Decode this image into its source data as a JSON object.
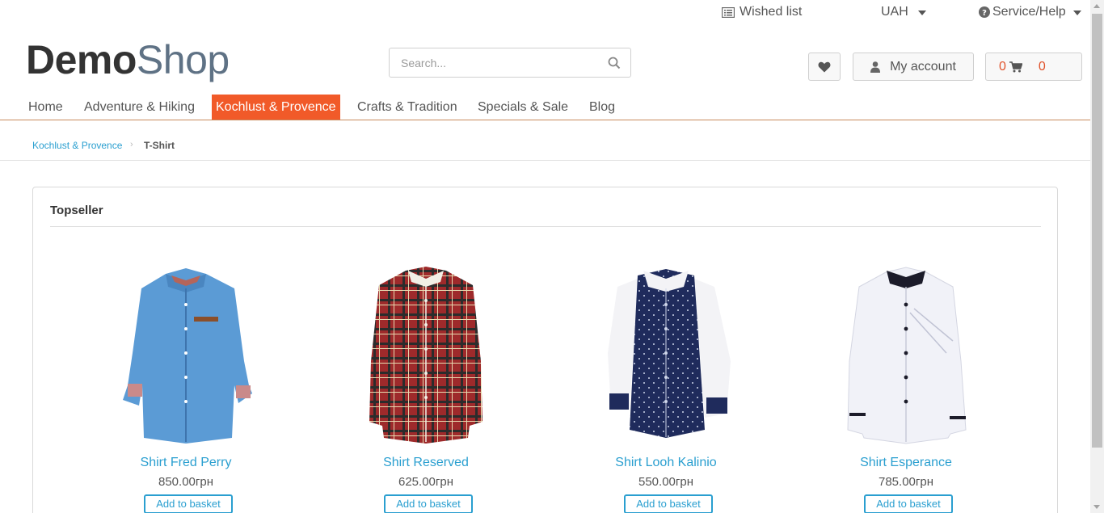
{
  "topbar": {
    "wished_list": "Wished list",
    "currency": "UAH",
    "service": "Service/Help"
  },
  "logo": {
    "part1": "Demo",
    "part2": "Shop"
  },
  "search": {
    "placeholder": "Search..."
  },
  "header": {
    "account_label": "My account",
    "cart_count": "0",
    "cart_total": "0"
  },
  "nav": {
    "items": [
      {
        "label": "Home"
      },
      {
        "label": "Adventure & Hiking"
      },
      {
        "label": "Kochlust & Provence"
      },
      {
        "label": "Crafts & Tradition"
      },
      {
        "label": "Specials & Sale"
      },
      {
        "label": "Blog"
      }
    ],
    "active_index": 2
  },
  "breadcrumb": {
    "parent": "Kochlust & Provence",
    "current": "T-Shirt"
  },
  "topseller": {
    "title": "Topseller",
    "products": [
      {
        "name": "Shirt Fred Perry",
        "price": "850.00грн",
        "button": "Add to basket"
      },
      {
        "name": "Shirt Reserved",
        "price": "625.00грн",
        "button": "Add to basket"
      },
      {
        "name": "Shirt Looh Kalinio",
        "price": "550.00грн",
        "button": "Add to basket"
      },
      {
        "name": "Shirt Esperance",
        "price": "785.00грн",
        "button": "Add to basket"
      }
    ]
  },
  "colors": {
    "accent": "#f15a29",
    "link": "#2a9fd0",
    "nav_border": "#c98a5d"
  },
  "icons": [
    "list-icon",
    "caret-down-icon",
    "question-circle-icon",
    "search-icon",
    "heart-icon",
    "user-icon",
    "cart-icon"
  ]
}
